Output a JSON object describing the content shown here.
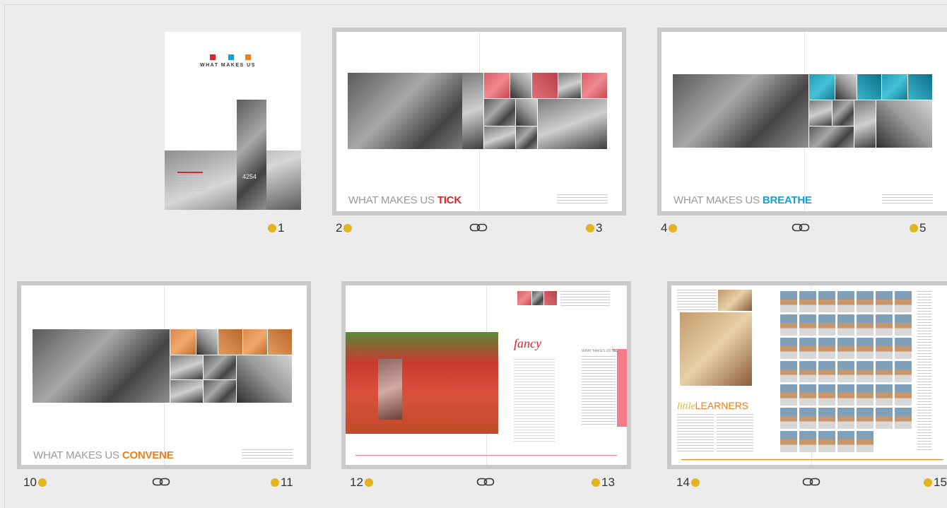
{
  "colors": {
    "yellow_dot": "#e2b41e",
    "red": "#e0222b",
    "blue": "#12a3d4",
    "orange": "#ef7d1a",
    "pink": "#f27c8c"
  },
  "cover": {
    "title": "WHAT MAKES US",
    "page_number": "1",
    "sign_number": "4254"
  },
  "spreads": [
    {
      "left_page": "2",
      "right_page": "3",
      "title_prefix": "WHAT MAKES US ",
      "title_accent": "TICK"
    },
    {
      "left_page": "4",
      "right_page": "5",
      "title_prefix": "WHAT MAKES US ",
      "title_accent": "BREATHE"
    },
    {
      "left_page": "10",
      "right_page": "11",
      "title_prefix": "WHAT MAKES US ",
      "title_accent": "CONVENE"
    },
    {
      "left_page": "12",
      "right_page": "13",
      "heading": "fancy",
      "small_heading_prefix": "WHAT MAKES US ",
      "small_heading_accent": "TICK"
    },
    {
      "left_page": "14",
      "right_page": "15",
      "heading_prefix": "little",
      "heading_accent": "LEARNERS"
    }
  ],
  "icons": {
    "page_marker": "yellow-dot-icon",
    "link": "chain-link-icon"
  }
}
